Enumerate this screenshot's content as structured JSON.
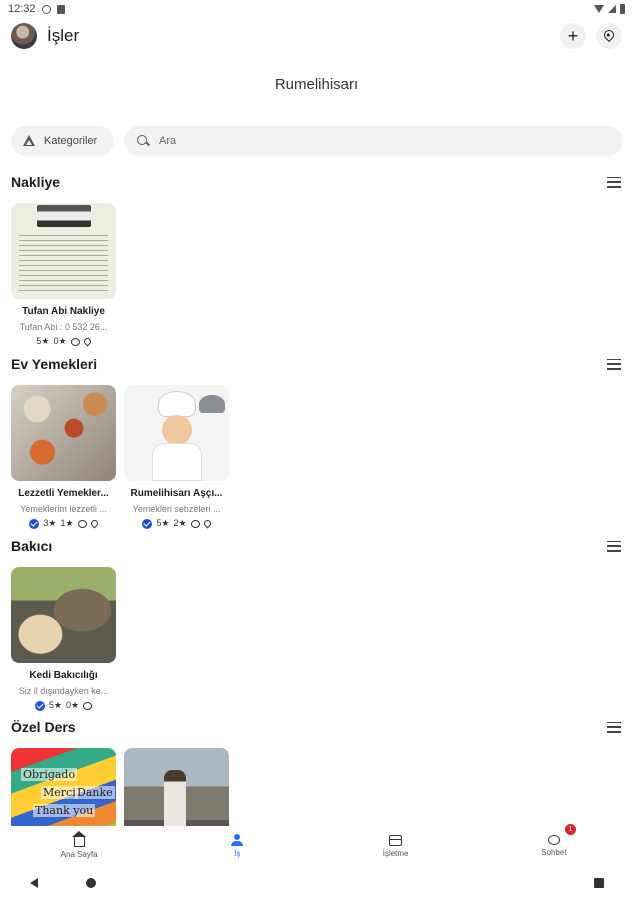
{
  "status_bar": {
    "time": "12:32"
  },
  "app_bar": {
    "title": "İşler"
  },
  "location": "Rumelihisarı",
  "filters": {
    "category_label": "Kategoriler",
    "search_placeholder": "Ara"
  },
  "sections": [
    {
      "title": "Nakliye",
      "cards": [
        {
          "title": "Tufan Abi Nakliye",
          "subtitle": "Tufan Abi : 0 532 26...",
          "rating": "5★",
          "count": "0★",
          "verified": false,
          "has_location": true
        }
      ]
    },
    {
      "title": "Ev Yemekleri",
      "cards": [
        {
          "title": "Lezzetli Yemekler...",
          "subtitle": "Yemeklerim lezzetli ...",
          "rating": "3★",
          "count": "1★",
          "verified": true,
          "has_location": true
        },
        {
          "title": "Rumelihisarı Aşçı...",
          "subtitle": "Yemekleri sebzeleri ...",
          "rating": "5★",
          "count": "2★",
          "verified": true,
          "has_location": true
        }
      ]
    },
    {
      "title": "Bakıcı",
      "cards": [
        {
          "title": "Kedi Bakıcılığı",
          "subtitle": "Siz il dışındayken ke...",
          "rating": "5★",
          "count": "0★",
          "verified": true,
          "has_location": false
        }
      ]
    },
    {
      "title": "Özel Ders",
      "cards": [
        {
          "thumb_words": [
            "Obrigado",
            "Merci",
            "Thank you",
            "Danke"
          ]
        },
        {}
      ]
    }
  ],
  "bottom_nav": [
    {
      "label": "Ana Sayfa",
      "icon": "home-icon",
      "active": false
    },
    {
      "label": "İş",
      "icon": "user-icon",
      "active": true
    },
    {
      "label": "İşletme",
      "icon": "store-icon",
      "active": false
    },
    {
      "label": "Sohbet",
      "icon": "chat-icon",
      "active": false,
      "badge": "1"
    }
  ],
  "colors": {
    "accent": "#2a6df4",
    "verified": "#1e4fd8",
    "badge": "#e0202a",
    "chip_bg": "#f2f2f4"
  }
}
